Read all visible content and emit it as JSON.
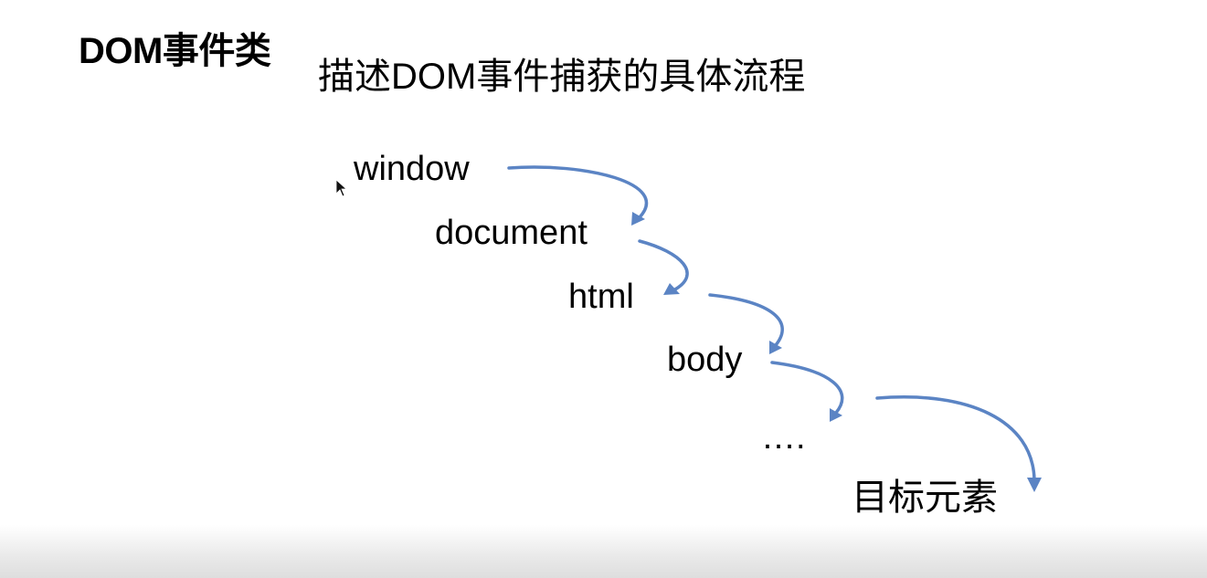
{
  "section_title": "DOM事件类",
  "subtitle": "描述DOM事件捕获的具体流程",
  "flow": {
    "nodes": [
      "window",
      "document",
      "html",
      "body",
      "….",
      "目标元素"
    ]
  },
  "arrow_color": "#5b84c4",
  "icons": {
    "cursor": "mouse-pointer-icon"
  }
}
